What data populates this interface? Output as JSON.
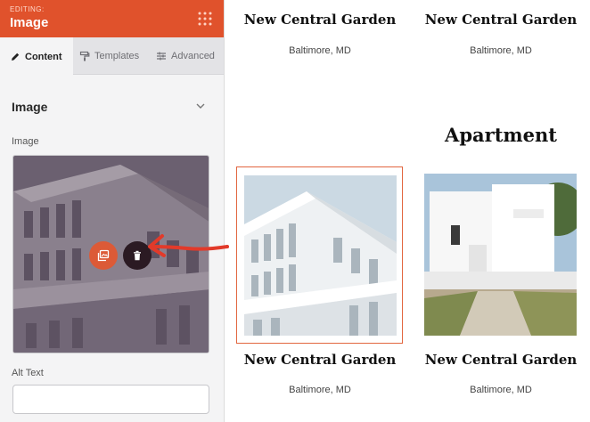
{
  "editor": {
    "editing_label": "EDITING:",
    "title": "Image",
    "tabs": [
      {
        "label": "Content",
        "icon": "pencil-icon",
        "active": true
      },
      {
        "label": "Templates",
        "icon": "paint-roller-icon",
        "active": false
      },
      {
        "label": "Advanced",
        "icon": "sliders-icon",
        "active": false
      }
    ],
    "section_title": "Image",
    "image_field_label": "Image",
    "alt_text_label": "Alt Text",
    "alt_text_value": "",
    "accent_color": "#e0522c"
  },
  "preview": {
    "heading": "Apartment",
    "cards": [
      {
        "title": "New Central Garden",
        "location": "Baltimore, MD"
      },
      {
        "title": "New Central Garden",
        "location": "Baltimore, MD"
      },
      {
        "title": "New Central Garden",
        "location": "Baltimore, MD"
      },
      {
        "title": "New Central Garden",
        "location": "Baltimore, MD"
      }
    ]
  }
}
